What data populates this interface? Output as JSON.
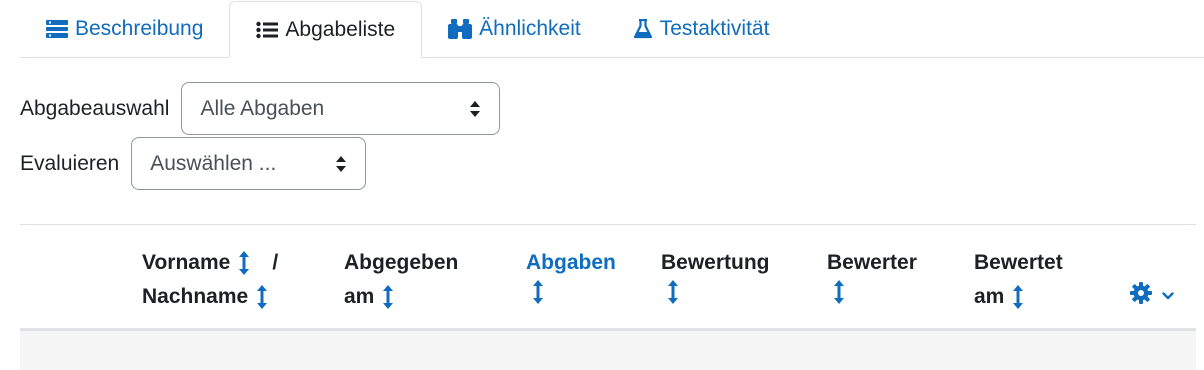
{
  "tabs": [
    {
      "label": "Beschreibung",
      "icon": "list-box-icon",
      "active": false
    },
    {
      "label": "Abgabeliste",
      "icon": "list-icon",
      "active": true
    },
    {
      "label": "Ähnlichkeit",
      "icon": "binoculars-icon",
      "active": false
    },
    {
      "label": "Testaktivität",
      "icon": "flask-icon",
      "active": false
    }
  ],
  "filters": {
    "submission_label": "Abgabeauswahl",
    "submission_value": "Alle Abgaben",
    "evaluate_label": "Evaluieren",
    "evaluate_value": "Auswählen ..."
  },
  "table": {
    "headers": {
      "firstname": "Vorname",
      "separator": "/",
      "lastname": "Nachname",
      "submitted_1": "Abgegeben",
      "submitted_2": "am",
      "submissions": "Abgaben",
      "grade": "Bewertung",
      "grader": "Bewerter",
      "graded_1": "Bewertet",
      "graded_2": "am"
    }
  },
  "colors": {
    "link": "#0f6cbf",
    "text": "#1d2125",
    "border": "#dee2e6"
  }
}
